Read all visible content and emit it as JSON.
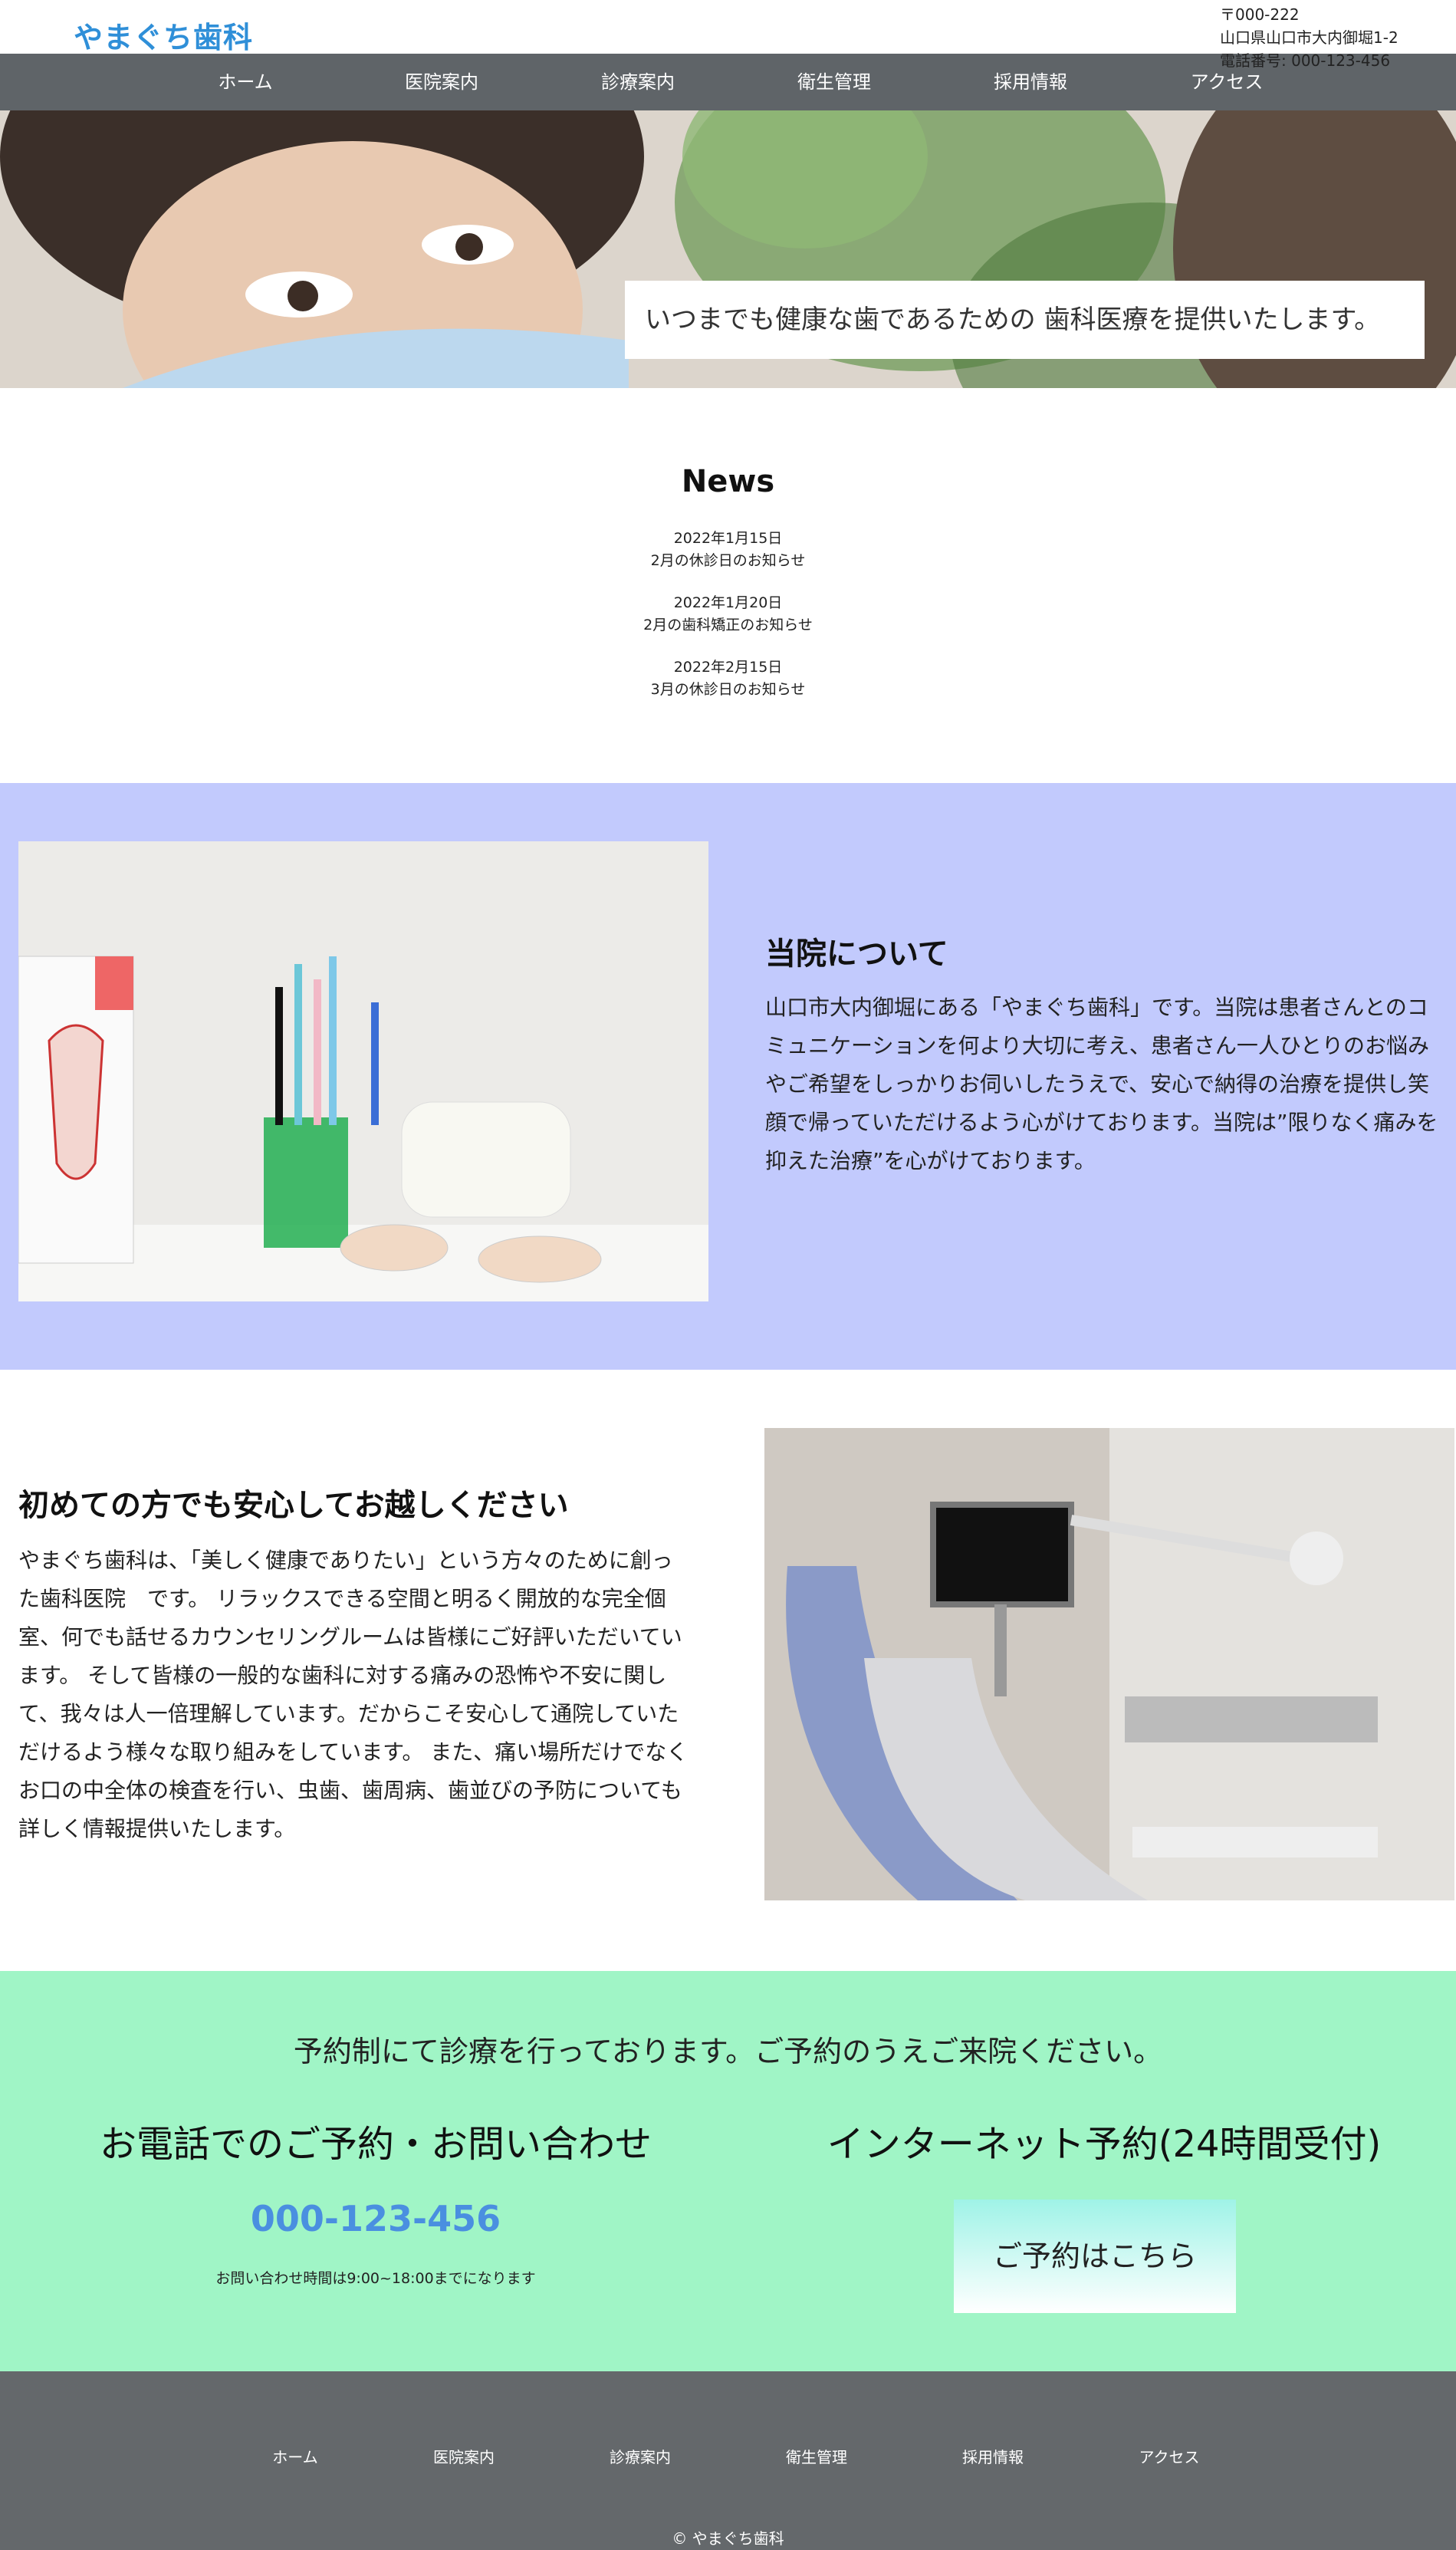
{
  "site": {
    "logo": "やまぐち歯科",
    "postal": "〒000-222",
    "address": "山口県山口市大内御堀1-2",
    "phone_line": "電話番号: 000-123-456",
    "brand_color": "#2f8fd8"
  },
  "nav": [
    {
      "label": "ホーム"
    },
    {
      "label": "医院案内"
    },
    {
      "label": "診療案内"
    },
    {
      "label": "衛生管理"
    },
    {
      "label": "採用情報"
    },
    {
      "label": "アクセス"
    }
  ],
  "hero": {
    "caption": "いつまでも健康な歯であるための 歯科医療を提供いたします。"
  },
  "news": {
    "title": "News",
    "items": [
      {
        "date": "2022年1月15日",
        "text": "2月の休診日のお知らせ"
      },
      {
        "date": "2022年1月20日",
        "text": "2月の歯科矯正のお知らせ"
      },
      {
        "date": "2022年2月15日",
        "text": "3月の休診日のお知らせ"
      }
    ]
  },
  "about": {
    "title": "当院について",
    "text": "山口市大内御堀にある「やまぐち歯科」です。当院は患者さんとのコミュニケーションを何より大切に考え、患者さん一人ひとりのお悩みやご希望をしっかりお伺いしたうえで、安心で納得の治療を提供し笑顔で帰っていただけるよう心がけております。当院は”限りなく痛みを抑えた治療”を心がけております。",
    "bg_color": "#c2cafd"
  },
  "first_visit": {
    "title": "初めての方でも安心してお越しください",
    "text": "やまぐち歯科は、「美しく健康でありたい」という方々のために創った歯科医院　です。 リラックスできる空間と明るく開放的な完全個室、何でも話せるカウンセリングルームは皆様にご好評いただいています。 そして皆様の一般的な歯科に対する痛みの恐怖や不安に関して、我々は人一倍理解しています。だからこそ安心して通院していただけるよう様々な取り組みをしています。 また、痛い場所だけでなくお口の中全体の検査を行い、虫歯、歯周病、歯並びの予防についても詳しく情報提供いたします。"
  },
  "reservation": {
    "lead": "予約制にて診療を行っております。ご予約のうえご来院ください。",
    "phone_heading": "お電話でのご予約・お問い合わせ",
    "phone_number": "000-123-456",
    "phone_note": "お問い合わせ時間は9:00~18:00までになります",
    "net_heading": "インターネット予約(24時間受付)",
    "button_label": "ご予約はこちら",
    "bg_color": "#a0f5c6"
  },
  "footer": {
    "links": [
      {
        "label": "ホーム"
      },
      {
        "label": "医院案内"
      },
      {
        "label": "診療案内"
      },
      {
        "label": "衛生管理"
      },
      {
        "label": "採用情報"
      },
      {
        "label": "アクセス"
      }
    ],
    "copyright": "© やまぐち歯科"
  }
}
